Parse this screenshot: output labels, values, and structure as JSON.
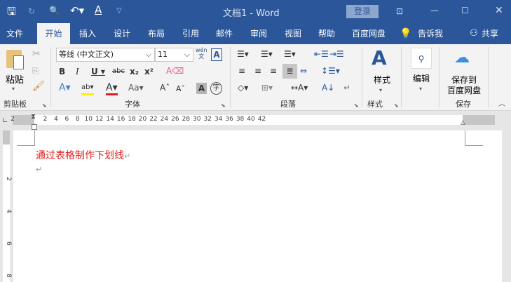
{
  "titlebar": {
    "title": "文档1  -  Word",
    "login": "登录"
  },
  "tabs": [
    "文件",
    "开始",
    "插入",
    "设计",
    "布局",
    "引用",
    "邮件",
    "审阅",
    "视图",
    "帮助",
    "百度网盘"
  ],
  "tell_me": "告诉我",
  "share": "共享",
  "ribbon": {
    "clipboard": {
      "paste": "粘贴",
      "label": "剪贴板"
    },
    "font": {
      "name": "等线 (中文正文)",
      "size": "11",
      "label": "字体",
      "phonetic": "wén\n文"
    },
    "paragraph": {
      "label": "段落"
    },
    "styles": {
      "button": "样式",
      "label": "样式"
    },
    "editing": {
      "button": "编辑"
    },
    "save": {
      "button_line1": "保存到",
      "button_line2": "百度网盘",
      "label": "保存"
    }
  },
  "ruler": {
    "ticks": [
      "2",
      "2",
      "4",
      "6",
      "8",
      "10",
      "12",
      "14",
      "16",
      "18",
      "20",
      "22",
      "24",
      "26",
      "28",
      "30",
      "32",
      "34",
      "36",
      "38",
      "40",
      "42"
    ]
  },
  "vruler": {
    "ticks": [
      "2",
      "4",
      "6",
      "8"
    ]
  },
  "document": {
    "line1": "通过表格制作下划线",
    "para_mark": "↵"
  },
  "colors": {
    "brand": "#2b579a",
    "text_red": "#e02020"
  }
}
